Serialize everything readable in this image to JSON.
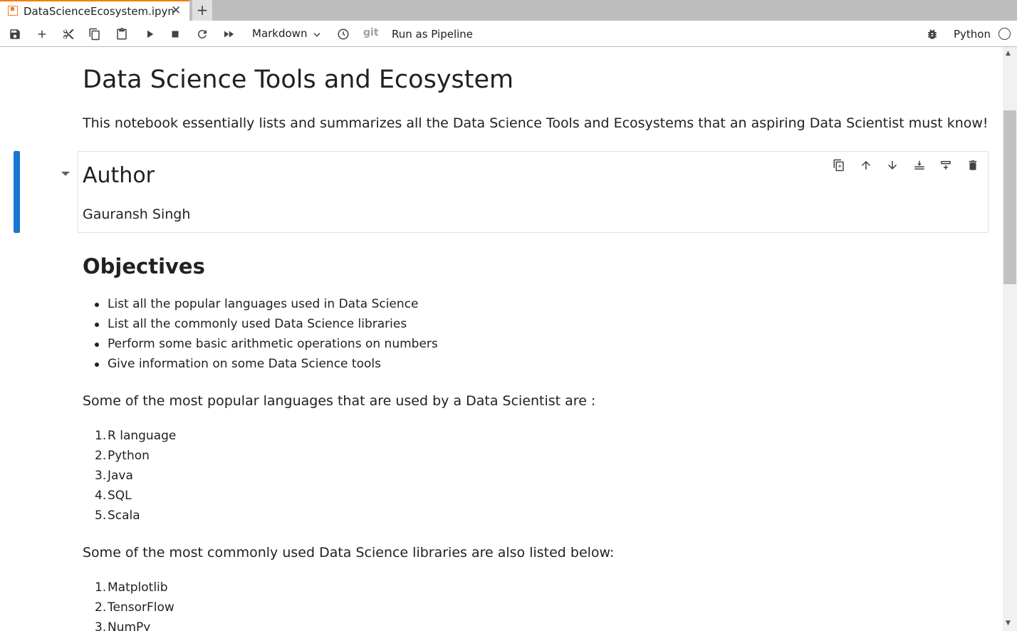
{
  "tab": {
    "title": "DataScienceEcosystem.ipyn",
    "close": "✕",
    "add": "+"
  },
  "toolbar": {
    "cell_type": "Markdown",
    "git": "git",
    "run_pipeline": "Run as Pipeline",
    "kernel": "Python",
    "icons": [
      "save-icon",
      "add-cell-icon",
      "cut-icon",
      "copy-icon",
      "paste-icon",
      "run-icon",
      "stop-icon",
      "restart-icon",
      "fast-forward-icon",
      "clock-icon",
      "bug-icon"
    ]
  },
  "notebook": {
    "title": "Data Science Tools and Ecosystem",
    "intro": "This notebook essentially lists and summarizes all the Data Science Tools and Ecosystems that an aspiring Data Scientist must know!",
    "author_heading": "Author",
    "author_name": "Gauransh Singh",
    "objectives_heading": "Objectives",
    "objectives": [
      "List all the popular languages used in Data Science",
      "List all the commonly used Data Science libraries",
      "Perform some basic arithmetic operations on numbers",
      "Give information on some Data Science tools"
    ],
    "languages_intro": "Some of the most popular languages that are used by a Data Scientist are :",
    "languages": [
      "R language",
      "Python",
      "Java",
      "SQL",
      "Scala"
    ],
    "libraries_intro": "Some of the most commonly used Data Science libraries are also listed below:",
    "libraries": [
      "Matplotlib",
      "TensorFlow",
      "NumPy"
    ],
    "cell_tool_icons": [
      "duplicate-cell-icon",
      "move-up-icon",
      "move-down-icon",
      "insert-below-icon",
      "insert-above-icon",
      "delete-cell-icon"
    ]
  }
}
